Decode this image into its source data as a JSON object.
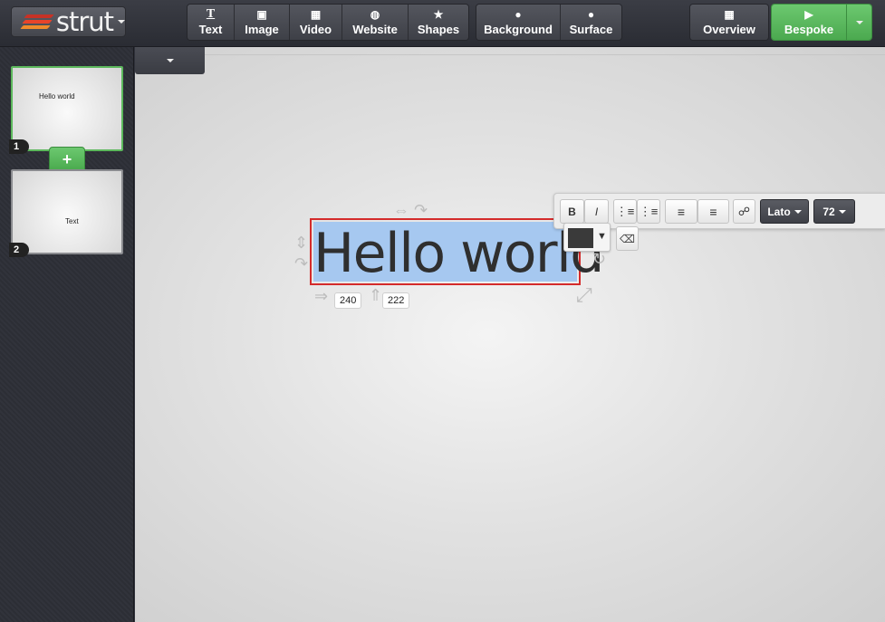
{
  "app": {
    "logo_text": "strut",
    "logo_stripes": [
      "#e8442a",
      "#f08b2b",
      "#c73226"
    ]
  },
  "toolbar": {
    "insert": [
      {
        "label": "Text",
        "icon": "text-icon",
        "glyph": "T"
      },
      {
        "label": "Image",
        "icon": "image-icon",
        "glyph": "▣"
      },
      {
        "label": "Video",
        "icon": "video-icon",
        "glyph": "▦"
      },
      {
        "label": "Website",
        "icon": "globe-icon",
        "glyph": "◍"
      },
      {
        "label": "Shapes",
        "icon": "star-icon",
        "glyph": "★"
      }
    ],
    "style": [
      {
        "label": "Background",
        "icon": "droplet-icon",
        "glyph": "💧"
      },
      {
        "label": "Surface",
        "icon": "droplet-icon",
        "glyph": "💧"
      }
    ],
    "overview_label": "Overview",
    "overview_glyph": "▦",
    "present_label": "Bespoke",
    "present_glyph": "▶",
    "accent_color": "#5cb85c"
  },
  "slides": [
    {
      "number": "1",
      "text": "Hello world",
      "active": true
    },
    {
      "number": "2",
      "text": "Text",
      "active": false
    }
  ],
  "add_slide_label": "+",
  "canvas": {
    "text": "Hello world",
    "x_value": "240",
    "y_value": "222",
    "selection_color": "#a6c8f0",
    "border_color": "#d42b2b"
  },
  "text_toolbar": {
    "bold": "B",
    "italic": "I",
    "font": "Lato",
    "size": "72",
    "color_swatch": "#3a3a3a",
    "swatch_caret": "▼"
  }
}
